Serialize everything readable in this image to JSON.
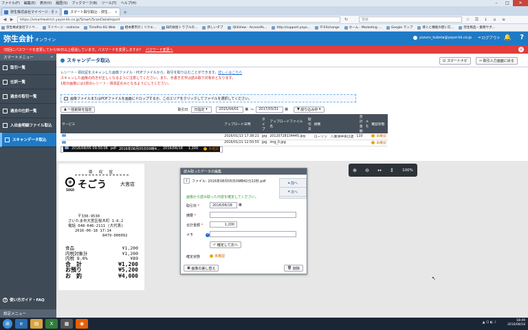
{
  "browser": {
    "menu": [
      "ファイル(F)",
      "編集(E)",
      "表示(V)",
      "履歴(S)",
      "ブックマーク(B)",
      "ツール(T)",
      "ヘルプ(H)"
    ],
    "tabs": [
      {
        "label": "弥生株式会社マイページ - 弥…"
      },
      {
        "label": "スマート取引取込 - 弥生…"
      }
    ],
    "new_tab": "+",
    "url": "https://smartrestrict.yayoi-kk.co.jp/Smart/ScanDataImport",
    "search_placeholder": "検索",
    "bookmarks": [
      "弥生株式会社マイペ…",
      "マイページ - redmine",
      "TimePro-XG Web",
      "相本都市計 | リクエ…",
      "知的財産トラブルの…",
      "新しいタブ",
      "QlikView - AccessPo…",
      "http://support.yayo…",
      "IT-EXchange",
      "ホーム - Marketing …",
      "Google マップ",
      "導入と機能の使い方…",
      "弥生製品・業務サポ…"
    ]
  },
  "header": {
    "logo": "弥生会計",
    "logo_sub": "オンライン",
    "user": "yozuru_kubota@yayoi-kk.co.jp",
    "logout": "ログアウト",
    "help": "?"
  },
  "alert": {
    "text": "!前回にパスワードを変更してから90日以上経過しています。パスワードを変更しますか？",
    "link": "パスワード変更へ"
  },
  "sidebar": {
    "title": "スマートメニュー",
    "items": [
      {
        "label": "取引一覧"
      },
      {
        "label": "仕訳一覧"
      },
      {
        "label": "過去の取引一覧"
      },
      {
        "label": "過去の仕訳一覧"
      },
      {
        "label": "入出金明細ファイル取込"
      },
      {
        "label": "スキャンデータ取込"
      }
    ],
    "guide": "使い方ガイド・FAQ",
    "settings": "設定メニュー"
  },
  "page": {
    "title": "スキャンデータ取込",
    "smart_navi": "スマートナビ",
    "back_button": "取引入力画面に戻る",
    "intro_line1": "レシート・領収証をスキャンした画像ファイル・PDFファイルから、取引を取り込むことができます。",
    "intro_link": "詳しくはこちら",
    "intro_line2": "スキャンした画像の向きが正しくなるように注意してください。また、手書き文字は読み取り対象外となります。",
    "intro_line3": "1枚の画像には1枚のレシート・領収証のみとなるようにしてください。",
    "drop_text": "画像ファイルまたはPDFファイルを画面にドロップするか、このエリアをクリックしてファイルを選択してください。"
  },
  "filters": {
    "bulk_button": "一括削除を指定",
    "date_label": "取引日",
    "date_type": "日指定",
    "date_from": "2015/04/01",
    "date_sep": "〜",
    "date_to": "2017/03/31",
    "filter_button": "絞り込み中"
  },
  "table": {
    "headers": [
      "サービス",
      "アップロード日時",
      "タイプ",
      "アップロードファイル名",
      "取引日",
      "摘要",
      "合計金額",
      "メモ",
      "確認状態"
    ],
    "rows": [
      {
        "uploaded": "2016/01/13 17:38:21",
        "type": "jpg",
        "file": "20120728134445.jpg",
        "date": "",
        "memo_text": "ローソン　八重洲中央口店",
        "amount": "110",
        "memo": "",
        "status": "未確認"
      },
      {
        "uploaded": "2016/01/21 12:50:55",
        "type": "jpg",
        "file": "img_0.jpg",
        "date": "",
        "memo_text": "",
        "amount": "",
        "memo": "",
        "status": "未確認"
      },
      {
        "uploaded": "2016/08/05 09:50:06",
        "type": "pdf",
        "file": "2016年08月05日09時4…",
        "date": "2016/06/18",
        "memo_text": "",
        "amount": "1,200",
        "memo": "",
        "status": "未確認"
      }
    ]
  },
  "receipt": {
    "title": "領　収　証",
    "brand": "そごう",
    "store": "大宮店",
    "sogo": "SOGO",
    "addr": [
      "〒330-9530",
      "さいたま市大宮区桜木町 1-6-2",
      "電話 048-646-2111 (大代表)",
      "2016-06-18 17:14",
      "8479-000092"
    ],
    "items": [
      {
        "k": "食品",
        "v": "¥1,200"
      },
      {
        "k": "内税対象計",
        "v": "¥1,200"
      },
      {
        "k": "内税      8.0%",
        "v": "¥89"
      }
    ],
    "totals": [
      {
        "k": "合　計",
        "v": "¥1,200"
      },
      {
        "k": "お預り",
        "v": "¥5,200"
      },
      {
        "k": "お　釣",
        "v": "¥4,000"
      }
    ]
  },
  "zoom": {
    "level": "100%"
  },
  "dialog": {
    "title": "読み取ったデータの編集",
    "file": "ファイル: 2016年08月05日09時42分22秒.pdf",
    "prev": "前へ",
    "next": "次へ",
    "message": "画像から読み取った内容を確定してください。",
    "date_label": "取引日",
    "date_value": "2016/06/18",
    "desc_label": "摘要",
    "amount_label": "合計金額",
    "amount_value": "1,200",
    "memo_label": "メモ",
    "confirm_button": "確定して次へ",
    "status_label": "確定状態",
    "status_value": "未確認",
    "replace_button": "画像の差し替え",
    "delete_button": "削除"
  },
  "taskbar": {
    "time": "18:49",
    "date": "2016/08/18"
  }
}
